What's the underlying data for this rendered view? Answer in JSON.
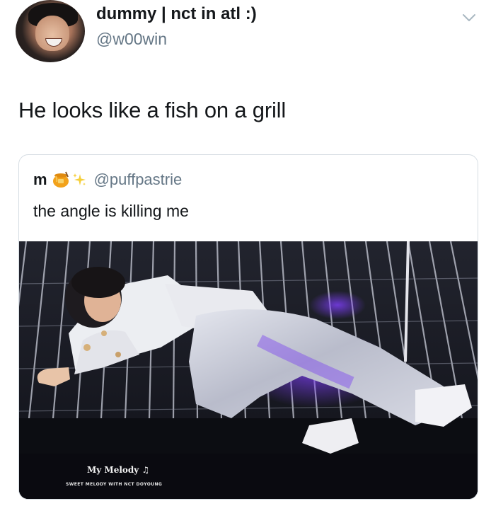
{
  "tweet": {
    "display_name": "dummy | nct in atl :)",
    "handle": "@w00win",
    "text": "He looks like a fish on a grill",
    "menu_icon": "chevron-down-icon"
  },
  "quoted_tweet": {
    "display_name": "m",
    "emoji_icons": [
      "honey-pot-icon",
      "sparkles-icon"
    ],
    "handle": "@puffpastrie",
    "text": "the angle is killing me",
    "media": {
      "watermark_title": "My Melody ♫",
      "watermark_subtitle": "SWEET MELODY WITH NCT DOYOUNG"
    }
  },
  "colors": {
    "text_primary": "#14171a",
    "text_secondary": "#657786",
    "card_border": "#d6dde3"
  }
}
